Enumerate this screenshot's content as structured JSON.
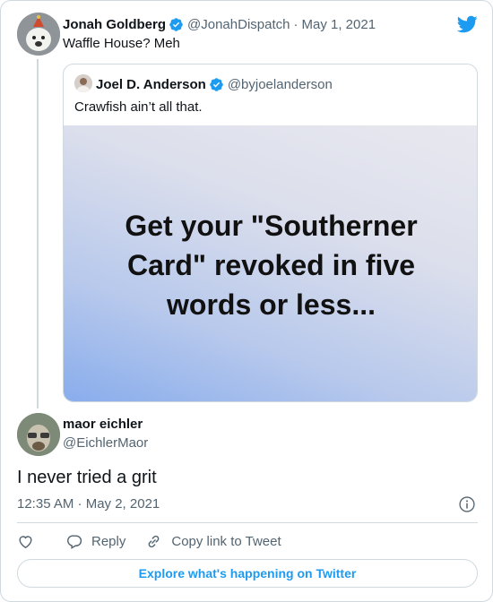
{
  "colors": {
    "accent": "#1d9bf0",
    "muted": "#536471",
    "border": "#cfd9de",
    "text": "#0f1419"
  },
  "parent": {
    "name": "Jonah Goldberg",
    "handle": "@JonahDispatch",
    "separator": "·",
    "date": "May 1, 2021",
    "text": "Waffle House? Meh"
  },
  "quoted": {
    "name": "Joel D. Anderson",
    "handle": "@byjoelanderson",
    "text": "Crawfish ain’t all that.",
    "media_lines": [
      "Get your \"Southerner",
      "Card\" revoked in five",
      "words or less..."
    ]
  },
  "reply": {
    "name": "maor eichler",
    "handle": "@EichlerMaor",
    "text": "I never tried a grit",
    "timestamp": "12:35 AM · May 2, 2021"
  },
  "actions": {
    "reply_label": "Reply",
    "copy_link_label": "Copy link to Tweet"
  },
  "explore_label": "Explore what's happening on Twitter",
  "icons": [
    "twitter-bird-icon",
    "verified-badge-icon",
    "info-icon",
    "heart-icon",
    "reply-icon",
    "link-icon"
  ]
}
